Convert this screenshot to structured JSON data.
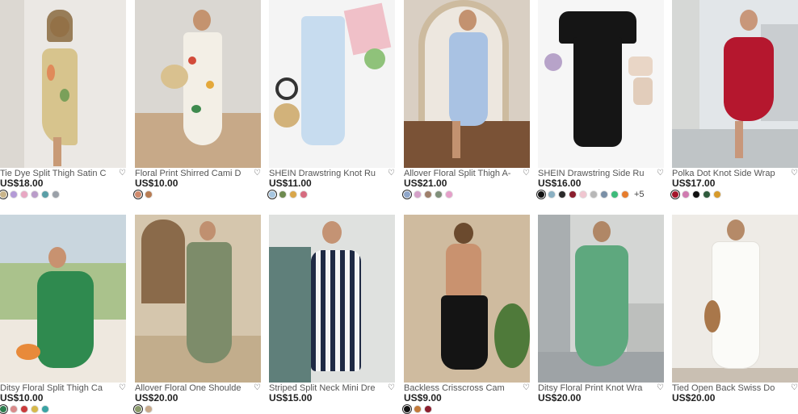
{
  "products": [
    {
      "title": "Tie Dye Split Thigh Satin C",
      "price": "US$18.00",
      "colors": [
        "#c8b48a",
        "#b39ad6",
        "#e8a7c3",
        "#b99cc9",
        "#5a9ea6",
        "#9aa0a8"
      ],
      "bg": "#e9e6e2",
      "dress": "#d7c48d"
    },
    {
      "title": "Floral Print Shirred Cami D",
      "price": "US$10.00",
      "colors": [
        "#d08a6c",
        "#b87c52"
      ],
      "bg": "#d9d6d1",
      "dress": "#f2efe6"
    },
    {
      "title": "SHEIN Drawstring Knot Ru",
      "price": "US$11.00",
      "colors": [
        "#a7c6e0",
        "#6d8a4f",
        "#d9a64a",
        "#d66b7f"
      ],
      "bg": "#f3f3f3",
      "dress": "#c7dcef"
    },
    {
      "title": "Allover Floral Split Thigh A-",
      "price": "US$21.00",
      "colors": [
        "#8fa6c9",
        "#d4a0c8",
        "#9e7f6a",
        "#7f8f7a",
        "#e59fc9"
      ],
      "bg": "#cfc7bd",
      "dress": "#a9c2e3"
    },
    {
      "title": "SHEIN Drawstring Side Ru",
      "price": "US$16.00",
      "colors": [
        "#111111",
        "#8ab0c2",
        "#2a2a2a",
        "#8b1e2d",
        "#f0c6d0",
        "#b7b7b7",
        "#7a8fa6",
        "#3dbb7a",
        "#e67d2e"
      ],
      "more": "+5",
      "bg": "#f7f7f7",
      "dress": "#151515"
    },
    {
      "title": "Polka Dot Knot Side Wrap",
      "price": "US$17.00",
      "colors": [
        "#a3142a",
        "#d07bb0",
        "#111111",
        "#2f5b3c",
        "#d79a2b"
      ],
      "bg": "#dfe3e6",
      "dress": "#b5172e"
    },
    {
      "title": "Ditsy Floral Split Thigh Ca",
      "price": "US$10.00",
      "colors": [
        "#2e7d4f",
        "#d98a8a",
        "#c93a3a",
        "#d6b84a",
        "#3aa3a3"
      ],
      "bg": "#9fb88a",
      "dress": "#2f8a4f"
    },
    {
      "title": "Allover Floral One Shoulde",
      "price": "US$20.00",
      "colors": [
        "#8a9a6a",
        "#c7a98a"
      ],
      "bg": "#cdbfa9",
      "dress": "#7d8c6a"
    },
    {
      "title": "Striped Split Neck Mini Dre",
      "price": "US$15.00",
      "colors": [],
      "bg": "#dcdedc",
      "dress": "#1f2a44"
    },
    {
      "title": "Backless Crisscross Cam",
      "price": "US$9.00",
      "colors": [
        "#111111",
        "#c27a3a",
        "#8b1e2d"
      ],
      "bg": "#cdb89c",
      "dress": "#141414"
    },
    {
      "title": "Ditsy Floral Print Knot Wra",
      "price": "US$20.00",
      "colors": [],
      "bg": "#d2d4d2",
      "dress": "#5ea87e"
    },
    {
      "title": "Tied Open Back Swiss Do",
      "price": "US$20.00",
      "colors": [],
      "bg": "#efece7",
      "dress": "#fbfbf8"
    }
  ],
  "heart_icon": "heart-outline"
}
